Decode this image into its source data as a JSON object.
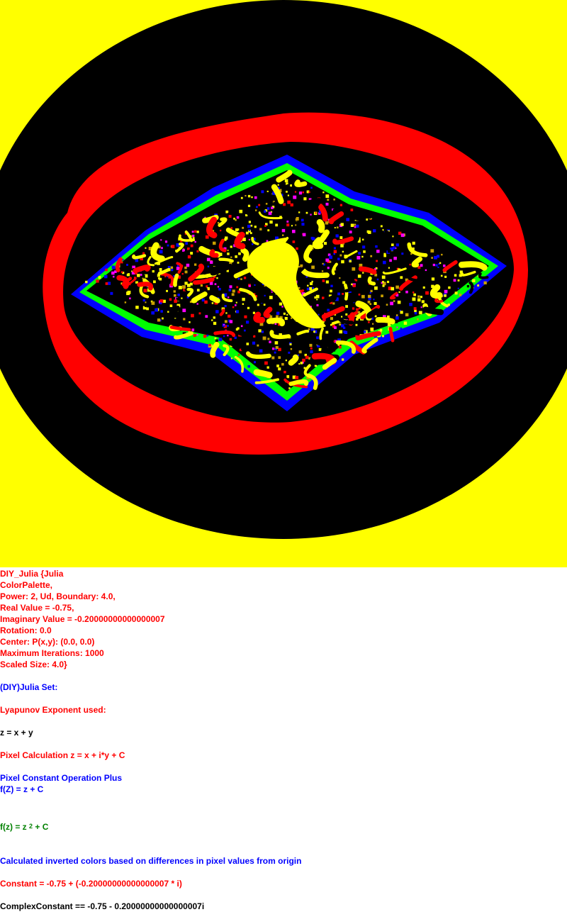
{
  "colors": {
    "background": "#ffff00",
    "outer_band": "#000000",
    "middle_band": "#ff0000",
    "inner_band": "#000000",
    "edge_blue": "#0000ff",
    "edge_green": "#00ff00",
    "accent_magenta": "#ff00ff",
    "accent_gold": "#c8a000",
    "text_red": "#ff0000",
    "text_blue": "#0000ff",
    "text_green": "#008000"
  },
  "params": {
    "l1": "DIY_Julia {Julia",
    "l2": "ColorPalette,",
    "l3": "Power: 2, Ud, Boundary: 4.0,",
    "l4": "Real Value = -0.75,",
    "l5": "Imaginary Value = -0.20000000000000007",
    "l6": "Rotation: 0.0",
    "l7": "Center: P(x,y): (0.0, 0.0)",
    "l8": "Maximum Iterations: 1000",
    "l9": "Scaled Size: 4.0}"
  },
  "info": {
    "set_name": "(DIY)Julia Set:",
    "lyapunov": "Lyapunov Exponent used:",
    "z_def": "z = x + y",
    "pixel_calc": "Pixel Calculation z = x + i*y + C",
    "pixel_const": "Pixel Constant Operation Plus",
    "f_Z": "f(Z) = z + C",
    "fz_pre": "f(z) = z ",
    "fz_exp": "2",
    "fz_post": " + C",
    "inverted": "Calculated inverted colors based on differences in pixel values from origin",
    "constant": "Constant = -0.75 + (-0.20000000000000007 * i)",
    "complex_constant": "ComplexConstant == -0.75 - 0.20000000000000007i"
  }
}
